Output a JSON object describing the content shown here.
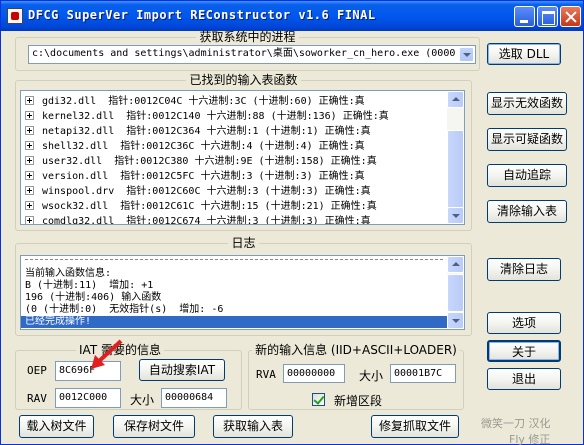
{
  "window": {
    "title": "DFCG SuperVer Import REConstructor v1.6 FINAL"
  },
  "process_group": {
    "title": "获取系统中的进程",
    "selected_process": "c:\\documents and settings\\administrator\\桌面\\soworker_cn_hero.exe (0000",
    "pick_dll_label": "选取 DLL"
  },
  "imports_group": {
    "title": "已找到的输入表函数",
    "rows": [
      "gdi32.dll  指针:0012C04C 十六进制:3C (十进制:60) 正确性:真",
      "kernel32.dll  指针:0012C140 十六进制:88 (十进制:136) 正确性:真",
      "netapi32.dll  指针:0012C364 十六进制:1 (十进制:1) 正确性:真",
      "shell32.dll  指针:0012C36C 十六进制:4 (十进制:4) 正确性:真",
      "user32.dll  指针:0012C380 十六进制:9E (十进制:158) 正确性:真",
      "version.dll  指针:0012C5FC 十六进制:3 (十进制:3) 正确性:真",
      "winspool.drv  指针:0012C60C 十六进制:3 (十进制:3) 正确性:真",
      "wsock32.dll  指针:0012C61C 十六进制:15 (十进制:21) 正确性:真",
      "comdlg32.dll  指针:0012C674 十六进制:3 (十进制:3) 正确性:真"
    ]
  },
  "side_buttons": {
    "show_invalid": "显示无效函数",
    "show_suspicious": "显示可疑函数",
    "auto_trace": "自动追踪",
    "clear_imports": "清除输入表",
    "clear_log": "清除日志",
    "options": "选项",
    "about": "关于",
    "exit": "退出"
  },
  "log_group": {
    "title": "日志",
    "lines": [
      "当前输入函数信息:",
      "B (十进制:11)  增加: +1",
      "196 (十进制:406) 输入函数",
      "(0 (十进制:0)  无效指针(s)  增加: -6"
    ],
    "selected_line": "已经完成操作!"
  },
  "iat_group": {
    "title": "IAT 需要的信息",
    "oep_label": "OEP",
    "oep_value": "8C696F",
    "auto_search_label": "自动搜索IAT",
    "rva_label": "RAV",
    "rva_value": "0012C000",
    "size_label": "大小",
    "size_value": "00000684"
  },
  "new_import_group": {
    "title": "新的输入信息 (IID+ASCII+LOADER)",
    "rva_label": "RVA",
    "rva_value": "00000000",
    "size_label": "大小",
    "size_value": "00001B7C",
    "new_section_label": "新增区段",
    "new_section_checked": true
  },
  "bottom_buttons": {
    "load_tree": "载入树文件",
    "save_tree": "保存树文件",
    "get_imports": "获取输入表",
    "fix_dump": "修复抓取文件"
  },
  "watermark": {
    "line1": "微笑一刀  汉化",
    "line2": "Fly  修正"
  },
  "colors": {
    "titlebar": "#0058ee",
    "selection": "#316ac5",
    "face": "#ece9d8",
    "arrow": "#e02020"
  }
}
